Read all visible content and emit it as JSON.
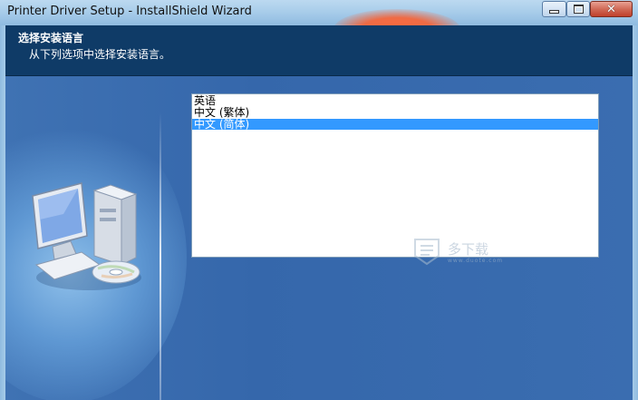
{
  "window": {
    "title": "Printer Driver Setup - InstallShield Wizard"
  },
  "header": {
    "title": "选择安装语言",
    "subtitle": "从下列选项中选择安装语言。"
  },
  "languages": {
    "items": [
      {
        "label": "英语",
        "selected": false
      },
      {
        "label": "中文 (繁体)",
        "selected": false
      },
      {
        "label": "中文 (简体)",
        "selected": true
      }
    ]
  },
  "watermark": {
    "text": "多下载",
    "sub": "www.duote.com"
  },
  "icons": {
    "minimize": "minimize-icon",
    "maximize": "maximize-icon",
    "close": "close-icon",
    "computer": "computer-icon"
  }
}
